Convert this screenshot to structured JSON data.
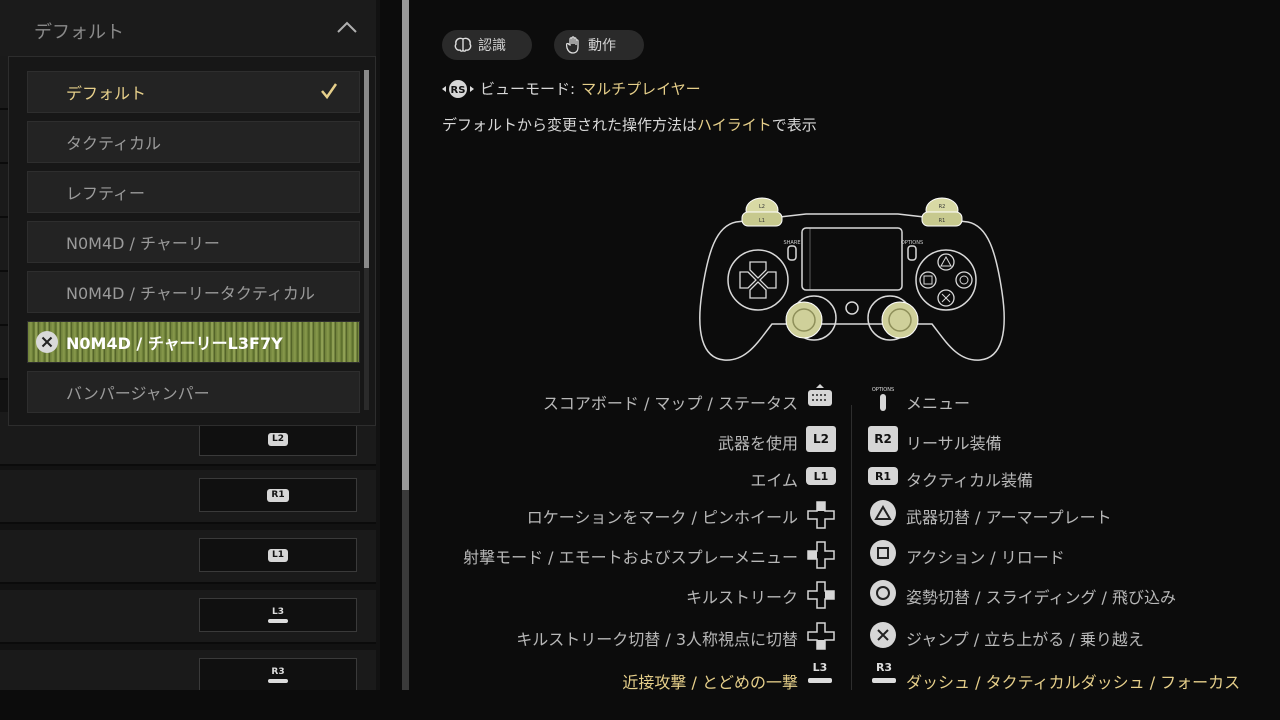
{
  "dropdown": {
    "selected": "デフォルト",
    "options": [
      {
        "label": "デフォルト"
      },
      {
        "label": "タクティカル"
      },
      {
        "label": "レフティー"
      },
      {
        "label": "N0M4D / チャーリー"
      },
      {
        "label": "N0M4D / チャーリータクティカル"
      },
      {
        "label": "N0M4D / チャーリーL3F7Y"
      },
      {
        "label": "バンパージャンパー"
      }
    ]
  },
  "binding_rows": [
    {
      "key": "L2"
    },
    {
      "key": "R1"
    },
    {
      "key": "L1"
    },
    {
      "key": "L3"
    },
    {
      "key": "R3"
    }
  ],
  "tabs": {
    "recognition": "認識",
    "action": "動作"
  },
  "view_mode": {
    "label": "ビューモード:",
    "value": "マルチプレイヤー",
    "button": "RS"
  },
  "subtitle": {
    "before": "デフォルトから変更された操作方法は",
    "highlight": "ハイライト",
    "after": "で表示"
  },
  "controller": {
    "share_label": "SHARE",
    "options_label": "OPTIONS",
    "l2": "L2",
    "l1": "L1",
    "r2": "R2",
    "r1": "R1"
  },
  "left_mappings": [
    {
      "label": "スコアボード / マップ / ステータス",
      "button": "touchpad"
    },
    {
      "label": "武器を使用",
      "button": "L2"
    },
    {
      "label": "エイム",
      "button": "L1"
    },
    {
      "label": "ロケーションをマーク / ピンホイール",
      "button": "dpad-up"
    },
    {
      "label": "射撃モード / エモートおよびスプレーメニュー",
      "button": "dpad-left"
    },
    {
      "label": "キルストリーク",
      "button": "dpad-right"
    },
    {
      "label": "キルストリーク切替 / 3人称視点に切替",
      "button": "dpad-down"
    },
    {
      "label": "近接攻撃 / とどめの一撃",
      "button": "L3"
    }
  ],
  "right_mappings": [
    {
      "label": "メニュー",
      "button": "OPTIONS"
    },
    {
      "label": "リーサル装備",
      "button": "R2"
    },
    {
      "label": "タクティカル装備",
      "button": "R1"
    },
    {
      "label": "武器切替 / アーマープレート",
      "button": "triangle"
    },
    {
      "label": "アクション / リロード",
      "button": "square"
    },
    {
      "label": "姿勢切替 / スライディング / 飛び込み",
      "button": "circle"
    },
    {
      "label": "ジャンプ / 立ち上がる / 乗り越え",
      "button": "cross"
    },
    {
      "label": "ダッシュ / タクティカルダッシュ / フォーカス",
      "button": "R3"
    }
  ],
  "colors": {
    "accent": "#e6cf8a",
    "highlight_green": "#889a4c",
    "text": "#b8b8b8"
  }
}
